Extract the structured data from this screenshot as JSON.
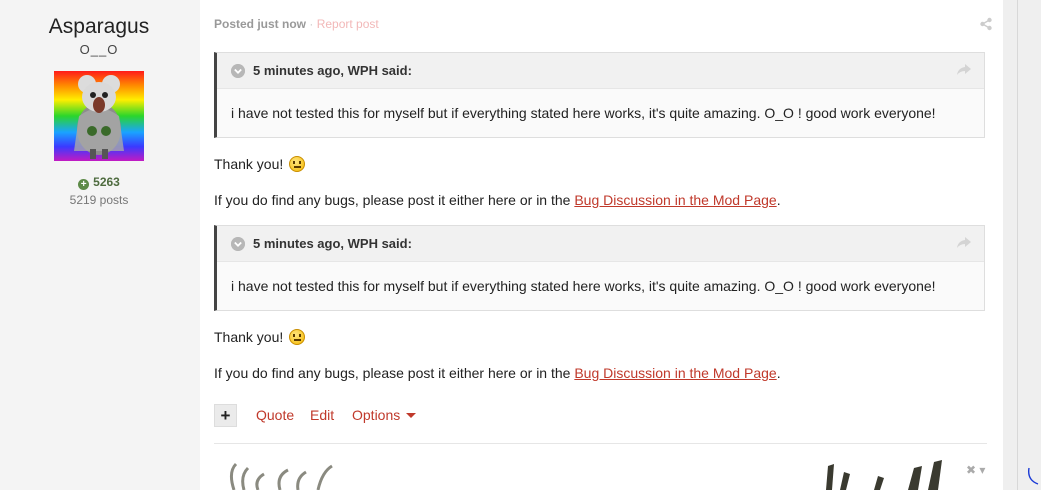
{
  "author": {
    "name": "Asparagus",
    "title": "O__O",
    "reputation": "5263",
    "post_count": "5219 posts"
  },
  "post": {
    "posted_label": "Posted just now",
    "separator": "·",
    "report_label": "Report post",
    "quotes": [
      {
        "citation": "5 minutes ago, WPH said:",
        "text": "i have not tested this for myself but if everything stated here works, it's quite amazing. O_O ! good work everyone!"
      },
      {
        "citation": "5 minutes ago, WPH said:",
        "text": "i have not tested this for myself but if everything stated here works, it's quite amazing. O_O ! good work everyone!"
      }
    ],
    "replies": [
      {
        "thanks": "Thank you!",
        "bugs_prefix": "If you do find any bugs, please post it either here or in the ",
        "bugs_link": "Bug Discussion in the Mod Page",
        "bugs_suffix": "."
      },
      {
        "thanks": "Thank you!",
        "bugs_prefix": "If you do find any bugs, please post it either here or in the ",
        "bugs_link": "Bug Discussion in the Mod Page",
        "bugs_suffix": "."
      }
    ],
    "actions": {
      "multiquote": "+",
      "quote": "Quote",
      "edit": "Edit",
      "options": "Options"
    },
    "signature_close": "✖"
  },
  "colors": {
    "accent": "#c0392b",
    "quote_border": "#444444",
    "reputation": "#4e6b3f"
  }
}
